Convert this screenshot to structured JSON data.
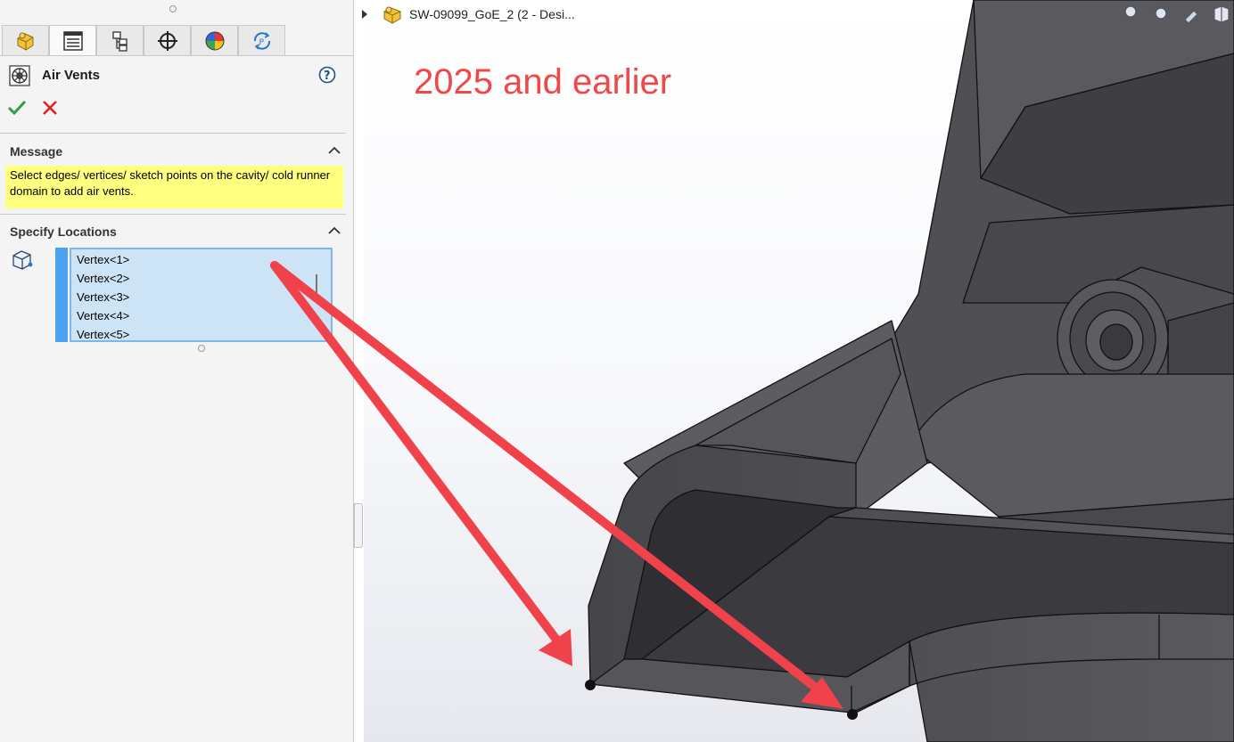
{
  "panel": {
    "title": "Air Vents",
    "tabs": [
      {
        "name": "feature-manager",
        "icon": "part-icon"
      },
      {
        "name": "property-manager",
        "icon": "list-icon",
        "active": true
      },
      {
        "name": "configuration-manager",
        "icon": "configuration-icon"
      },
      {
        "name": "dimxpert-manager",
        "icon": "crosshair-icon"
      },
      {
        "name": "display-manager",
        "icon": "appearance-icon"
      },
      {
        "name": "plastics-manager",
        "icon": "plastics-icon"
      }
    ],
    "message": {
      "header": "Message",
      "text": "Select edges/ vertices/ sketch points on the cavity/ cold runner domain to add air vents."
    },
    "locations": {
      "header": "Specify Locations",
      "items": [
        "Vertex<1>",
        "Vertex<2>",
        "Vertex<3>",
        "Vertex<4>",
        "Vertex<5>"
      ]
    }
  },
  "viewport": {
    "document_title": "SW-09099_GoE_2 (2 - Desi...",
    "caption": "2025 and earlier",
    "caption_color": "#f04848",
    "arrow_color": "#f0424a",
    "model_color": "#4e4e52"
  }
}
